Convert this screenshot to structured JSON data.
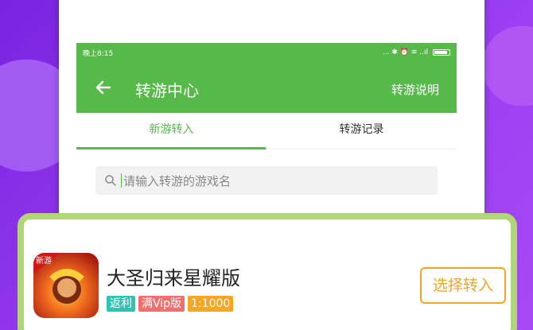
{
  "status_bar": {
    "time": "晚上8:15",
    "icons": "... ✱ ⏰ ≋ ..ıl"
  },
  "app_bar": {
    "title": "转游中心",
    "action": "转游说明"
  },
  "tabs": [
    {
      "label": "新游转入",
      "active": true
    },
    {
      "label": "转游记录",
      "active": false
    }
  ],
  "search": {
    "placeholder": "请输入转游的游戏名"
  },
  "game": {
    "name": "大圣归来星耀版",
    "icon_label": "新游",
    "tags": [
      {
        "label": "返利",
        "color": "#2cc5b4"
      },
      {
        "label": "满Vip版",
        "color": "#f07070"
      },
      {
        "label": "1:1000",
        "color": "#f5a623"
      }
    ],
    "button_label": "选择转入"
  },
  "colors": {
    "accent": "#56b949",
    "background": "#8a32e8",
    "card_border": "#b3d57a",
    "button": "#f5a623"
  }
}
